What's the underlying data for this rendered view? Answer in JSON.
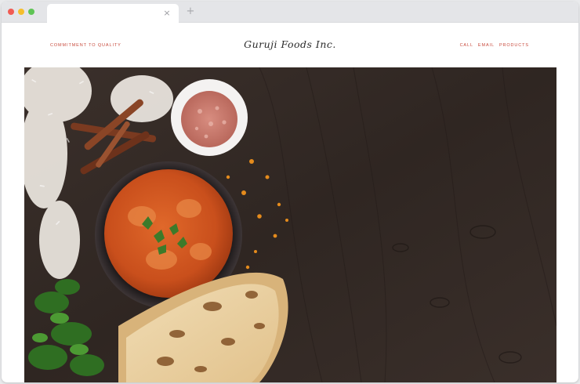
{
  "browser": {
    "tab_close_glyph": "×",
    "new_tab_glyph": "+"
  },
  "header": {
    "tagline": "COMMITMENT TO QUALITY",
    "brand": "Guruji Foods Inc.",
    "nav": [
      "CALL",
      "EMAIL",
      "PRODUCTS"
    ]
  },
  "colors": {
    "accent": "#c84a3c",
    "brand_text": "#2b2b2b",
    "chrome": "#e4e5e8",
    "wood": "#3a2e29"
  },
  "hero": {
    "icon": "food-photo",
    "description_visible": false
  }
}
